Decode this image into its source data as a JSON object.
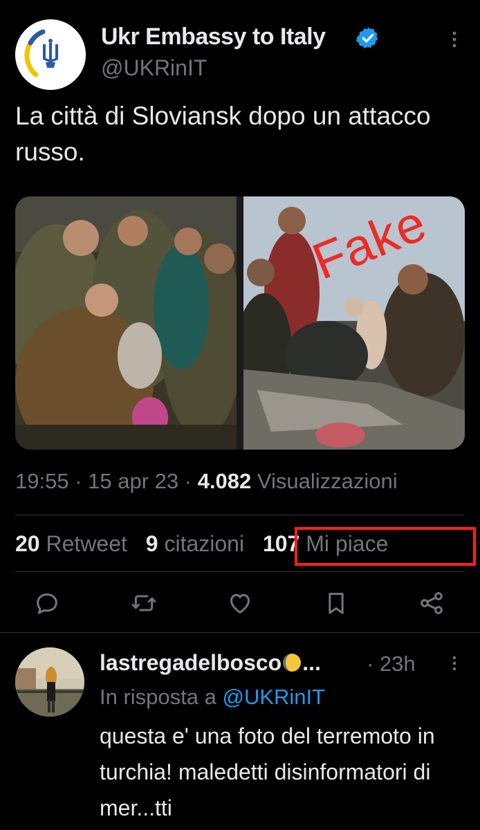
{
  "post": {
    "display_name": "Ukr Embassy to Italy",
    "handle": "@UKRinIT",
    "text": "La città di Sloviansk dopo un attacco russo.",
    "overlay_label": "Fake",
    "time": "19:55",
    "sep1": " · ",
    "date": "15 apr 23",
    "sep2": " · ",
    "views_count": "4.082",
    "views_label": " Visualizzazioni",
    "retweets_count": "20",
    "retweets_label": " Retweet",
    "quotes_count": "9",
    "quotes_label": " citazioni",
    "likes_count": "107",
    "likes_label": " Mi piace"
  },
  "icons": {
    "verified": "verified-badge-icon",
    "more": "more-vertical-icon",
    "reply": "reply-icon",
    "retweet": "retweet-icon",
    "like": "heart-icon",
    "bookmark": "bookmark-icon",
    "share": "share-icon",
    "moon": "moon-emoji-icon"
  },
  "reply": {
    "name": "lastregadelbosco",
    "ellipsis": "...",
    "time": " · 23h",
    "reply_prefix": "In risposta a ",
    "reply_mention": "@UKRinIT",
    "text": "questa e' una foto del terremoto in turchia! maledetti disinformatori di mer...tti"
  },
  "colors": {
    "background": "#000000",
    "text_primary": "#e7e9ea",
    "text_secondary": "#71767b",
    "accent": "#1d9bf0",
    "highlight": "#ff1f1f",
    "fake_label": "#ee2a24"
  }
}
